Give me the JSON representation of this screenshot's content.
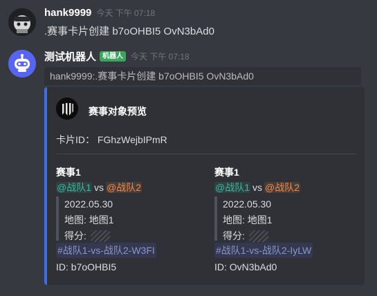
{
  "message1": {
    "username": "hank9999",
    "timestamp": "今天 下午 07:18",
    "content": ".赛事卡片创建  b7oOHBI5 OvN3bAd0"
  },
  "message2": {
    "username": "测试机器人",
    "bot_tag": "机器人",
    "timestamp": "今天 下午 07:18",
    "reply": "hank9999:.赛事卡片创建 b7oOHBI5 OvN3bAd0",
    "embed": {
      "accent_color": "#3e6ee4",
      "title": "赛事对象预览",
      "card_id": "卡片ID：  FGhzWejbIPmR",
      "matches": [
        {
          "title": "赛事1",
          "team_a": "@战队1",
          "vs": "vs",
          "team_b": "@战队2",
          "date": "2022.05.30",
          "map": "地图: 地图1",
          "score_label": "得分:",
          "channel": "#战队1-vs-战队2-W3FI",
          "id": "ID: b7oOHBI5"
        },
        {
          "title": "赛事1",
          "team_a": "@战队1",
          "vs": "vs",
          "team_b": "@战队2",
          "date": "2022.05.30",
          "map": "地图: 地图1",
          "score_label": "得分:",
          "channel": "#战队1-vs-战队2-IyLW",
          "id": "ID: OvN3bAd0"
        }
      ]
    }
  }
}
